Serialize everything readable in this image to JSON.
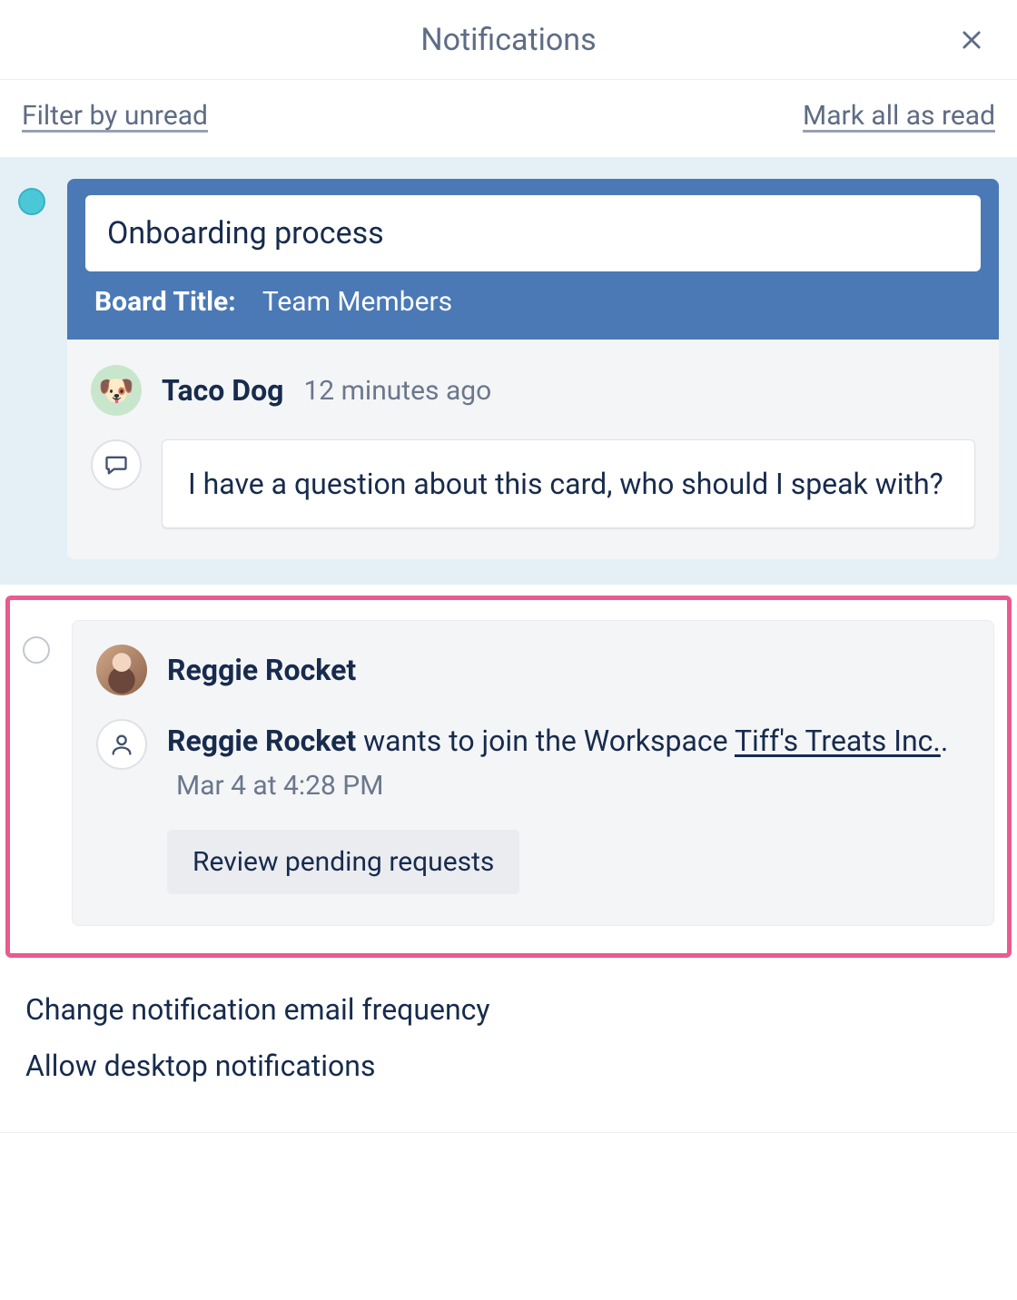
{
  "header": {
    "title": "Notifications",
    "close_icon": "close"
  },
  "filters": {
    "filter_unread": "Filter by unread",
    "mark_all_read": "Mark all as read"
  },
  "notifications": [
    {
      "unread": true,
      "card_title": "Onboarding process",
      "board_label": "Board Title:",
      "board_value": "Team Members",
      "author": "Taco Dog",
      "timestamp": "12 minutes ago",
      "comment": "I have a question about this card, who should I speak with?"
    },
    {
      "unread": false,
      "author": "Reggie Rocket",
      "request_actor": "Reggie Rocket",
      "request_mid": " wants to join the Workspace ",
      "workspace": "Tiff's Treats Inc.",
      "timestamp": "Mar 4 at 4:28 PM",
      "action_label": "Review pending requests"
    }
  ],
  "footer": {
    "change_frequency": "Change notification email frequency",
    "allow_desktop": "Allow desktop notifications"
  }
}
